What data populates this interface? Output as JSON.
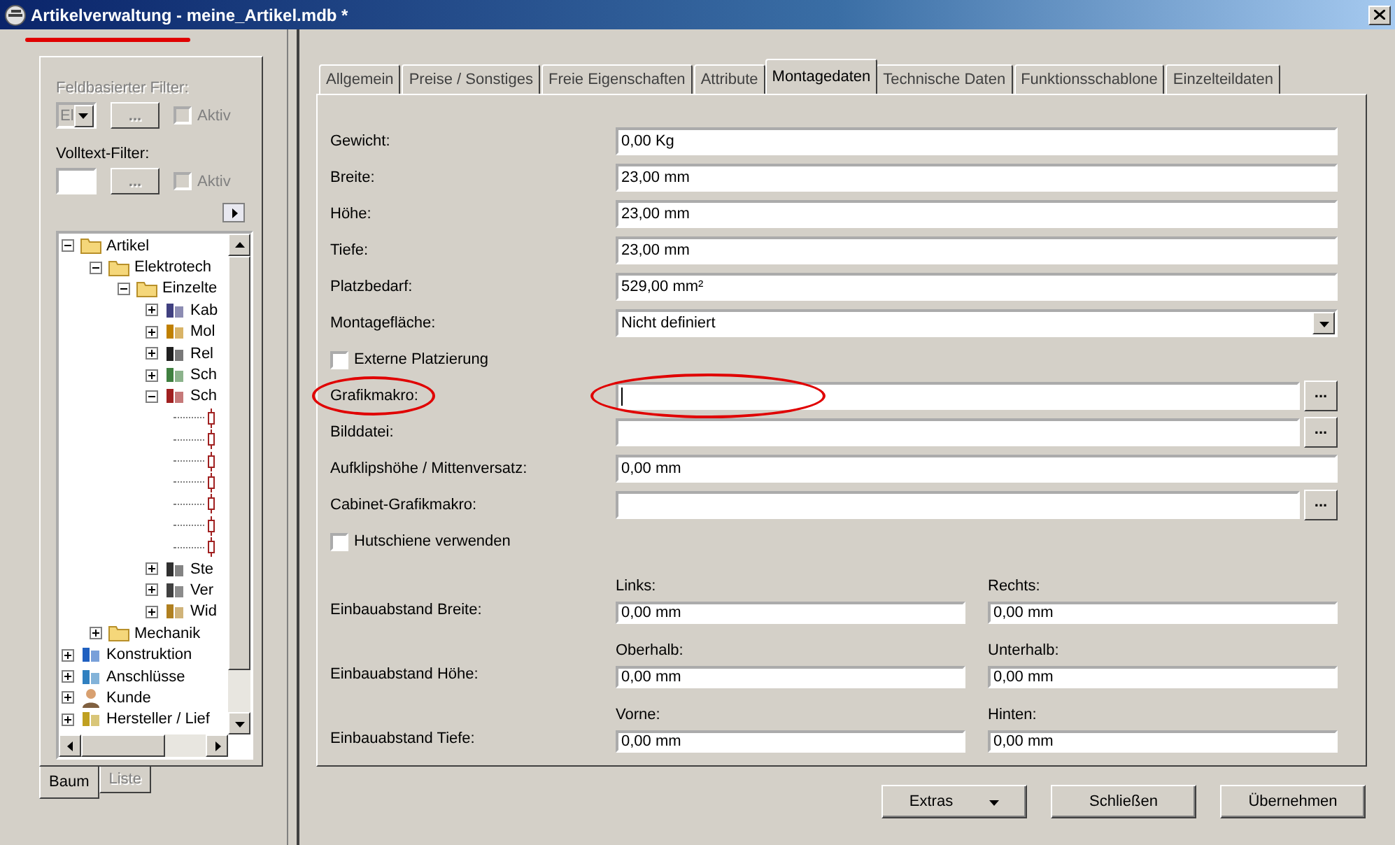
{
  "window": {
    "title": "Artikelverwaltung - meine_Artikel.mdb *",
    "title_underlined": true
  },
  "left_panel": {
    "field_filter": {
      "label": "Feldbasierter Filter:",
      "disabled": true,
      "value": "El",
      "button": {
        "label": "...",
        "disabled": true
      },
      "active": {
        "label": "Aktiv",
        "checked": false,
        "disabled": true
      }
    },
    "fulltext_filter": {
      "label": "Volltext-Filter:",
      "disabled": false,
      "button": {
        "label": "...",
        "disabled": true
      },
      "active": {
        "label": "Aktiv",
        "checked": false,
        "disabled": true
      }
    },
    "tree": [
      {
        "label": "Artikel",
        "kind": "folder",
        "expanded": true,
        "children": [
          {
            "label": "Elektrotech",
            "kind": "folder",
            "expanded": true,
            "children": [
              {
                "label": "Einzelte",
                "kind": "folder",
                "expanded": true,
                "children": [
                  {
                    "label": "Kab",
                    "kind": "cable",
                    "expanded": false
                  },
                  {
                    "label": "Mol",
                    "kind": "motor",
                    "expanded": false
                  },
                  {
                    "label": "Rel",
                    "kind": "relay",
                    "expanded": false
                  },
                  {
                    "label": "Sch",
                    "kind": "switch",
                    "expanded": false
                  },
                  {
                    "label": "Sch",
                    "kind": "terminal",
                    "expanded": true,
                    "children": [
                      {
                        "kind": "part"
                      },
                      {
                        "kind": "part"
                      },
                      {
                        "kind": "part"
                      },
                      {
                        "kind": "part"
                      },
                      {
                        "kind": "part"
                      },
                      {
                        "kind": "part"
                      },
                      {
                        "kind": "part"
                      }
                    ]
                  },
                  {
                    "label": "Ste",
                    "kind": "connector",
                    "expanded": false
                  },
                  {
                    "label": "Ver",
                    "kind": "distributor",
                    "expanded": false
                  },
                  {
                    "label": "Wid",
                    "kind": "resistor",
                    "expanded": false
                  }
                ]
              }
            ]
          },
          {
            "label": "Mechanik",
            "kind": "folder",
            "expanded": false
          }
        ]
      },
      {
        "label": "Konstruktion",
        "kind": "construction",
        "expanded": false
      },
      {
        "label": "Anschlüsse",
        "kind": "ports",
        "expanded": false
      },
      {
        "label": "Kunde",
        "kind": "customer",
        "expanded": false
      },
      {
        "label": "Hersteller / Lief",
        "kind": "supplier",
        "expanded": false
      }
    ],
    "tabs": [
      {
        "label": "Baum",
        "selected": true
      },
      {
        "label": "Liste",
        "selected": false
      }
    ]
  },
  "tabs": [
    {
      "label": "Allgemein",
      "selected": false
    },
    {
      "label": "Preise / Sonstiges",
      "selected": false
    },
    {
      "label": "Freie Eigenschaften",
      "selected": false
    },
    {
      "label": "Attribute",
      "selected": false
    },
    {
      "label": "Montagedaten",
      "selected": true
    },
    {
      "label": "Technische Daten",
      "selected": false
    },
    {
      "label": "Funktionsschablone",
      "selected": false
    },
    {
      "label": "Einzelteildaten",
      "selected": false
    }
  ],
  "form": [
    {
      "kind": "text",
      "label": "Gewicht:",
      "value": "0,00 Kg"
    },
    {
      "kind": "text",
      "label": "Breite:",
      "value": "23,00 mm"
    },
    {
      "kind": "text",
      "label": "Höhe:",
      "value": "23,00 mm"
    },
    {
      "kind": "text",
      "label": "Tiefe:",
      "value": "23,00 mm"
    },
    {
      "kind": "text",
      "label": "Platzbedarf:",
      "value": "529,00 mm²"
    },
    {
      "kind": "select",
      "label": "Montagefläche:",
      "value": "Nicht definiert"
    },
    {
      "kind": "checkbox",
      "label": "Externe Platzierung",
      "checked": false
    },
    {
      "kind": "browse",
      "label": "Grafikmakro:",
      "button": "...",
      "highlighted": true,
      "focused": true
    },
    {
      "kind": "browse",
      "label": "Bilddatei:",
      "button": "..."
    },
    {
      "kind": "text",
      "label": "Aufklipshöhe / Mittenversatz:",
      "value": "0,00 mm"
    },
    {
      "kind": "browse",
      "label": "Cabinet-Grafikmakro:",
      "button": "..."
    },
    {
      "kind": "checkbox",
      "label": "Hutschiene verwenden",
      "checked": false
    }
  ],
  "spacing": [
    {
      "label": "Einbauabstand Breite:",
      "fields": [
        {
          "label": "Links:",
          "value": "0,00 mm"
        },
        {
          "label": "Rechts:",
          "value": "0,00 mm"
        }
      ]
    },
    {
      "label": "Einbauabstand Höhe:",
      "fields": [
        {
          "label": "Oberhalb:",
          "value": "0,00 mm"
        },
        {
          "label": "Unterhalb:",
          "value": "0,00 mm"
        }
      ]
    },
    {
      "label": "Einbauabstand Tiefe:",
      "fields": [
        {
          "label": "Vorne:",
          "value": "0,00 mm"
        },
        {
          "label": "Hinten:",
          "value": "0,00 mm"
        }
      ]
    }
  ],
  "buttons": [
    {
      "label": "Extras",
      "kind": "menu"
    },
    {
      "label": "Schließen",
      "kind": "plain"
    },
    {
      "label": "Übernehmen",
      "kind": "plain"
    }
  ]
}
